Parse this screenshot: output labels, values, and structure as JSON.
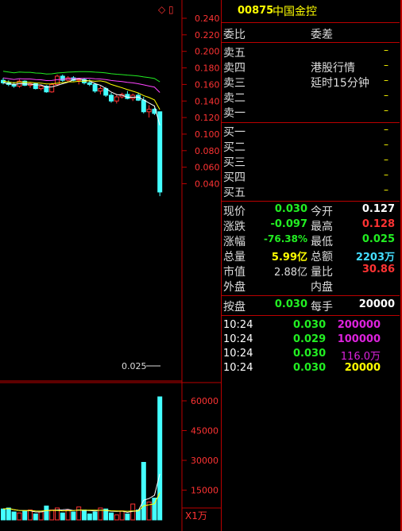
{
  "stock": {
    "code": "00875",
    "name": "中国金控"
  },
  "chart": {
    "price_axis": [
      "0.240",
      "0.220",
      "0.200",
      "0.180",
      "0.160",
      "0.140",
      "0.120",
      "0.100",
      "0.080",
      "0.060",
      "0.040"
    ],
    "volume_axis": [
      "60000",
      "45000",
      "30000",
      "15000"
    ],
    "volume_unit": "X1万",
    "low_marker": "0.025",
    "top_icons": "◇ ▯"
  },
  "chart_data": {
    "type": "candlestick",
    "price_ylim": [
      0.03,
      0.245
    ],
    "candles": [
      [
        0.165,
        0.168,
        0.16,
        0.162
      ],
      [
        0.162,
        0.165,
        0.158,
        0.16
      ],
      [
        0.16,
        0.163,
        0.156,
        0.158
      ],
      [
        0.158,
        0.166,
        0.156,
        0.164
      ],
      [
        0.164,
        0.165,
        0.158,
        0.159
      ],
      [
        0.159,
        0.162,
        0.156,
        0.161
      ],
      [
        0.161,
        0.162,
        0.154,
        0.155
      ],
      [
        0.155,
        0.16,
        0.153,
        0.158
      ],
      [
        0.158,
        0.159,
        0.15,
        0.151
      ],
      [
        0.151,
        0.162,
        0.15,
        0.16
      ],
      [
        0.16,
        0.172,
        0.158,
        0.17
      ],
      [
        0.17,
        0.172,
        0.163,
        0.165
      ],
      [
        0.165,
        0.17,
        0.163,
        0.168
      ],
      [
        0.168,
        0.17,
        0.164,
        0.165
      ],
      [
        0.165,
        0.168,
        0.16,
        0.166
      ],
      [
        0.166,
        0.168,
        0.16,
        0.162
      ],
      [
        0.162,
        0.166,
        0.158,
        0.16
      ],
      [
        0.16,
        0.162,
        0.15,
        0.152
      ],
      [
        0.152,
        0.158,
        0.148,
        0.155
      ],
      [
        0.155,
        0.157,
        0.145,
        0.147
      ],
      [
        0.147,
        0.15,
        0.138,
        0.14
      ],
      [
        0.14,
        0.148,
        0.137,
        0.145
      ],
      [
        0.145,
        0.15,
        0.143,
        0.148
      ],
      [
        0.148,
        0.152,
        0.142,
        0.143
      ],
      [
        0.143,
        0.149,
        0.14,
        0.147
      ],
      [
        0.147,
        0.15,
        0.14,
        0.141
      ],
      [
        0.141,
        0.145,
        0.125,
        0.127
      ],
      [
        0.127,
        0.135,
        0.12,
        0.13
      ],
      [
        0.13,
        0.132,
        0.123,
        0.125
      ],
      [
        0.127,
        0.127,
        0.025,
        0.03
      ]
    ],
    "volume": [
      5500,
      6000,
      4000,
      3500,
      4500,
      5000,
      3000,
      4000,
      7000,
      5000,
      6000,
      3500,
      5000,
      4000,
      6500,
      5000,
      3000,
      4000,
      6000,
      5500,
      3500,
      2500,
      4500,
      3000,
      8000,
      5000,
      29000,
      9000,
      11000,
      62000
    ],
    "volume_ylim": [
      0,
      65000
    ]
  },
  "quote": {
    "weibi_label": "委比",
    "weicha_label": "委差",
    "sell_labels": [
      "卖五",
      "卖四",
      "卖三",
      "卖二",
      "卖一"
    ],
    "buy_labels": [
      "买一",
      "买二",
      "买三",
      "买四",
      "买五"
    ],
    "dash": "–",
    "hk_note_1": "港股行情",
    "hk_note_2": "延时15分钟",
    "now_label": "现价",
    "now": "0.030",
    "open_label": "今开",
    "open": "0.127",
    "chg_label": "涨跌",
    "chg": "-0.097",
    "high_label": "最高",
    "high": "0.128",
    "pct_label": "涨幅",
    "pct": "-76.38%",
    "low_label": "最低",
    "low": "0.025",
    "vol_label": "总量",
    "vol": "5.99亿",
    "amt_label": "总额",
    "amt": "2203万",
    "mcap_label": "市值",
    "mcap": "2.88亿",
    "ratio_label": "量比",
    "ratio": "30.86",
    "outer_label": "外盘",
    "inner_label": "内盘",
    "close_label": "按盘",
    "close": "0.030",
    "lot_label": "每手",
    "lot": "20000"
  },
  "trades": [
    {
      "time": "10:24",
      "price": "0.030",
      "vol": "200000"
    },
    {
      "time": "10:24",
      "price": "0.029",
      "vol": "100000"
    },
    {
      "time": "10:24",
      "price": "0.030",
      "vol": "116.0万"
    },
    {
      "time": "10:24",
      "price": "0.030",
      "vol": "20000"
    }
  ]
}
